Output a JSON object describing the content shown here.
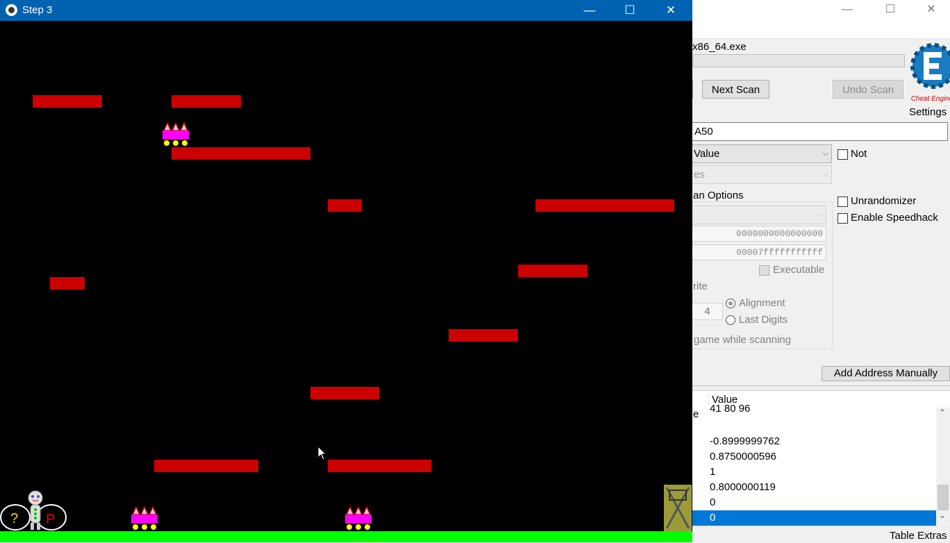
{
  "game": {
    "title": "Step 3",
    "controls": {
      "minimize": "—",
      "maximize": "☐",
      "close": "✕"
    },
    "colors": {
      "titlebar": "#0063b1",
      "background": "#000000",
      "platform": "#cc0000",
      "ground": "#00ff00",
      "enemy": "#ff00ff",
      "goal": "#9b9b3a"
    },
    "icons": [
      "game-app-icon",
      "enemy-sprite",
      "player-sprite",
      "question-mark-icon",
      "p-icon",
      "goal-door-icon",
      "mouse-cursor-icon"
    ]
  },
  "cheat_engine": {
    "window_controls": {
      "minimize": "—",
      "maximize": "☐",
      "close": "✕"
    },
    "process_name_partial": "x86_64.exe",
    "buttons": {
      "next_scan": "Next Scan",
      "undo_scan": "Undo Scan",
      "add_address": "Add Address Manually"
    },
    "settings_label": "Settings",
    "logo_caption": "Cheat Engine",
    "value_input": "A50",
    "scan_type": "Value",
    "value_type_partial": "es",
    "not_label": "Not",
    "scan_options_label": "an Options",
    "start_address": "0000000000000000",
    "stop_address": "00007fffffffffff",
    "executable_label": "Executable",
    "writable_partial": "rite",
    "alignment_value": "4",
    "alignment_label": "Alignment",
    "last_digits_label": "Last Digits",
    "pause_game_partial": "game while scanning",
    "unrandomizer_label": "Unrandomizer",
    "speedhack_label": "Enable Speedhack",
    "results": {
      "header_partial": "e",
      "header_value": "Value",
      "rows": [
        {
          "value": "41 80 96"
        },
        {
          "value": ""
        },
        {
          "value": "-0.8999999762"
        },
        {
          "value": "0.8750000596"
        },
        {
          "value": "1"
        },
        {
          "value": "0.8000000119"
        },
        {
          "value": "0"
        },
        {
          "value": "0"
        }
      ]
    },
    "table_extras": "Table Extras",
    "scroll_up": "⌃",
    "scroll_down": "⌄",
    "colors": {
      "selection": "#0078d7"
    }
  }
}
